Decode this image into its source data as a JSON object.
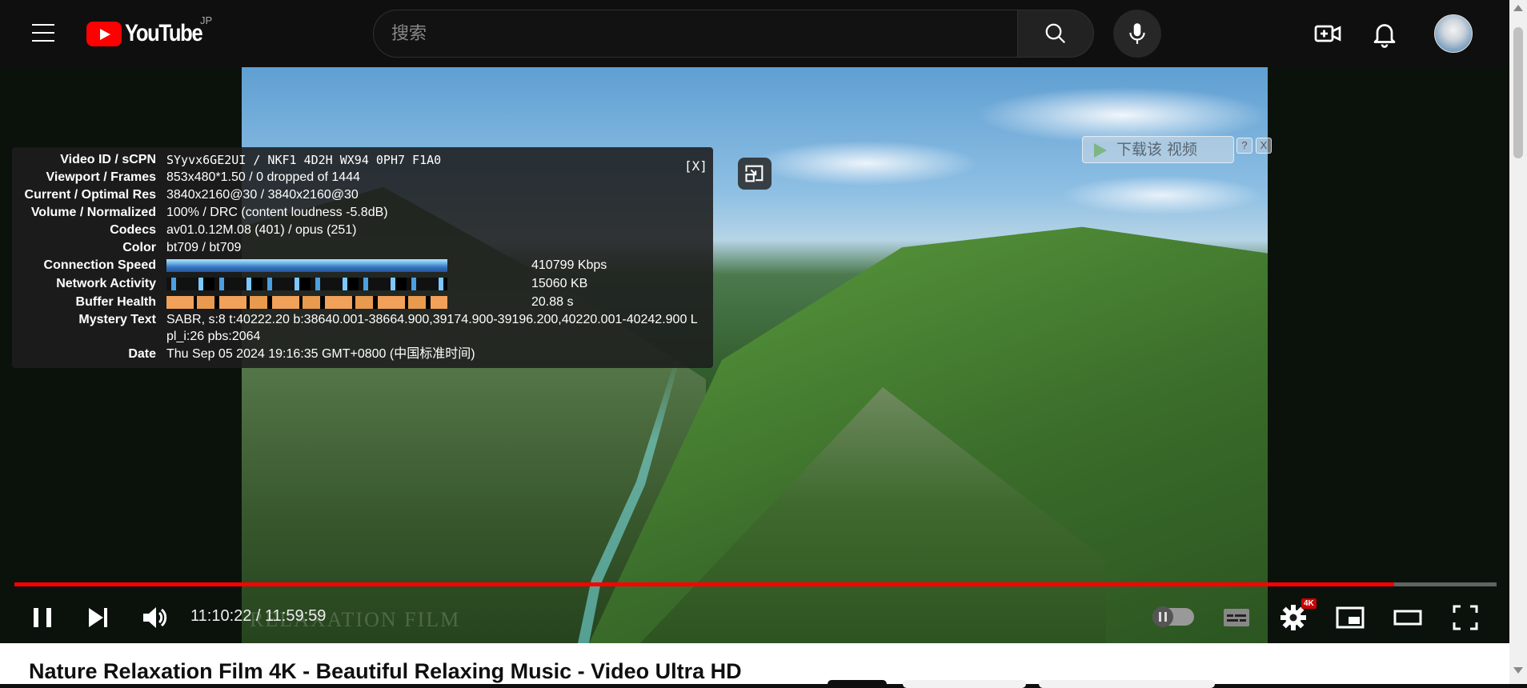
{
  "header": {
    "logo_text": "YouTube",
    "country_code": "JP",
    "search_placeholder": "搜索"
  },
  "download_overlay": {
    "label": "下载该 视频",
    "help": "?",
    "close": "X"
  },
  "stats": {
    "close_label": "[X]",
    "rows": [
      {
        "label": "Video ID / sCPN",
        "value": "SYyvx6GE2UI / NKF1 4D2H WX94 0PH7 F1A0"
      },
      {
        "label": "Viewport / Frames",
        "value": "853x480*1.50 / 0 dropped of 1444"
      },
      {
        "label": "Current / Optimal Res",
        "value": "3840x2160@30 / 3840x2160@30"
      },
      {
        "label": "Volume / Normalized",
        "value": "100% / DRC (content loudness -5.8dB)"
      },
      {
        "label": "Codecs",
        "value": "av01.0.12M.08 (401) / opus (251)"
      },
      {
        "label": "Color",
        "value": "bt709 / bt709"
      },
      {
        "label": "Connection Speed",
        "value": "410799 Kbps"
      },
      {
        "label": "Network Activity",
        "value": "15060 KB"
      },
      {
        "label": "Buffer Health",
        "value": "20.88 s"
      },
      {
        "label": "Mystery Text",
        "value": "SABR, s:8 t:40222.20 b:38640.001-38664.900,39174.900-39196.200,40220.001-40242.900 L",
        "value2": "pl_i:26 pbs:2064"
      },
      {
        "label": "Date",
        "value": "Thu Sep 05 2024 19:16:35 GMT+0800 (中国标准时间)"
      }
    ]
  },
  "player": {
    "time_display": "11:10:22 / 11:59:59",
    "progress_fraction": 0.931,
    "watermark": "RELAXATION FILM",
    "quality_badge": "4K",
    "accent_color": "#ff0000"
  },
  "video": {
    "title": "Nature Relaxation Film 4K - Beautiful Relaxing Music - Video Ultra HD"
  }
}
